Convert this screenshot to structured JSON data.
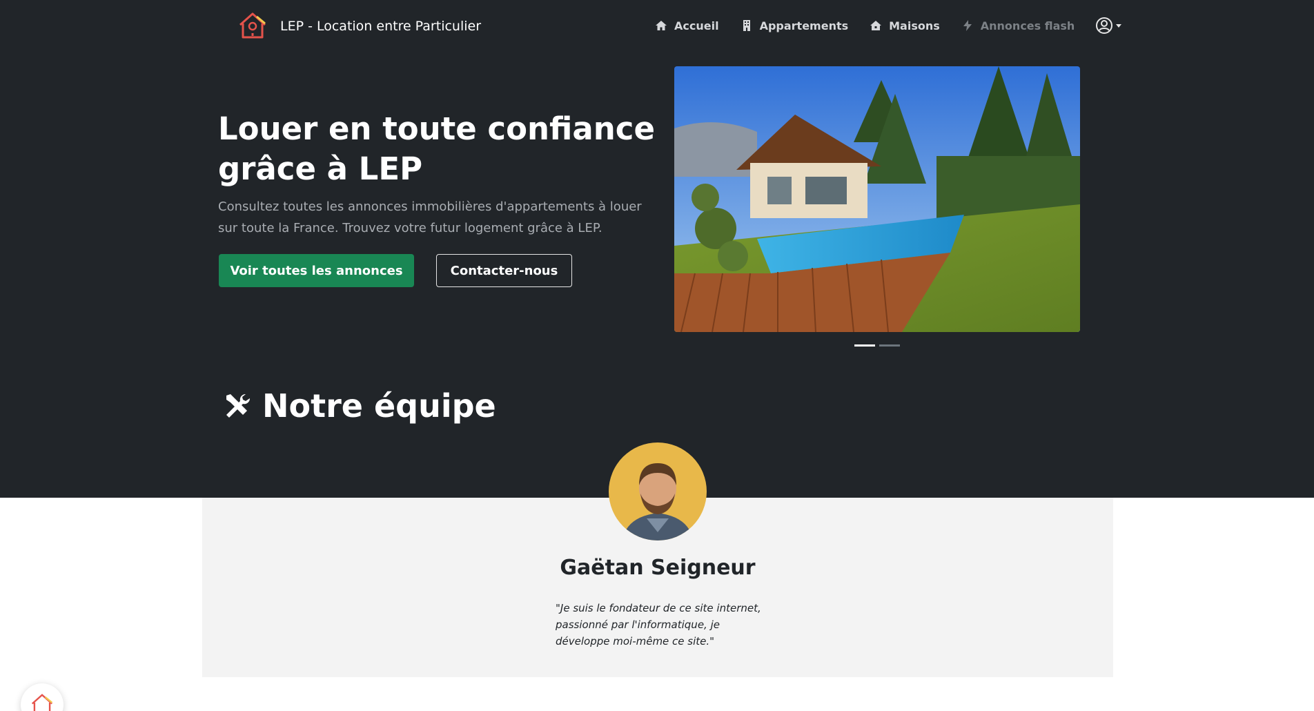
{
  "brand": {
    "name": "LEP - Location entre Particulier",
    "logo_icon": "house-logo-icon"
  },
  "nav": {
    "items": [
      {
        "label": "Accueil",
        "icon": "home-icon"
      },
      {
        "label": "Appartements",
        "icon": "building-icon"
      },
      {
        "label": "Maisons",
        "icon": "house-icon"
      },
      {
        "label": "Annonces flash",
        "icon": "lightning-icon"
      }
    ],
    "user_icon": "user-circle-icon"
  },
  "hero": {
    "title": "Louer en toute confiance grâce à LEP",
    "subtitle": "Consultez toutes les annonces immobilières d'appartements à louer sur toute la France. Trouvez votre futur logement grâce à LEP.",
    "primary_button": "Voir toutes les annonces",
    "secondary_button": "Contacter-nous"
  },
  "carousel": {
    "slide_count": 2,
    "active_index": 0
  },
  "team": {
    "heading": "Notre équipe",
    "heading_icon": "tools-icon",
    "member": {
      "name": "Gaëtan Seigneur",
      "quote": "\"Je suis le fondateur de ce site internet, passionné par l'informatique, je développe moi-même ce site.\""
    }
  },
  "colors": {
    "dark_bg": "#212529",
    "primary": "#198754",
    "card_bg": "#f3f3f3",
    "logo_red": "#e5534b",
    "logo_yellow": "#f2c94c"
  }
}
